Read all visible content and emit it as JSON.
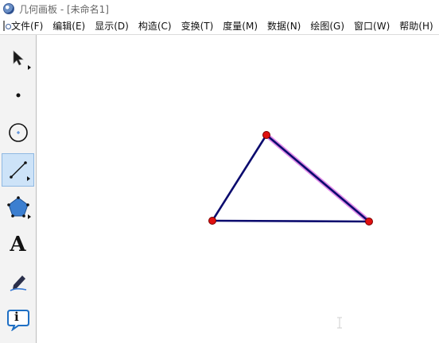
{
  "window": {
    "title": "几何画板 - [未命名1]"
  },
  "menubar": {
    "items": [
      "文件(F)",
      "编辑(E)",
      "显示(D)",
      "构造(C)",
      "变换(T)",
      "度量(M)",
      "数据(N)",
      "绘图(G)",
      "窗口(W)",
      "帮助(H)"
    ]
  },
  "toolbox": {
    "tools": [
      {
        "icon": "selection-arrow-icon",
        "active": false
      },
      {
        "icon": "point-tool-icon",
        "active": false
      },
      {
        "icon": "compass-tool-icon",
        "active": false
      },
      {
        "icon": "straightedge-tool-icon",
        "active": true
      },
      {
        "icon": "polygon-tool-icon",
        "active": false
      },
      {
        "icon": "text-tool-icon",
        "label": "A",
        "active": false
      },
      {
        "icon": "marker-tool-icon",
        "active": false
      },
      {
        "icon": "information-tool-icon",
        "label": "i",
        "active": false
      }
    ]
  },
  "canvas": {
    "colors": {
      "segment": "#0b0b6e",
      "point_fill": "#e01010",
      "point_stroke": "#7a0000",
      "selection_highlight": "#e08ae8"
    },
    "points": [
      {
        "id": "top"
      },
      {
        "id": "left"
      },
      {
        "id": "right"
      }
    ],
    "segments": [
      {
        "from": "top",
        "to": "left",
        "selected": false
      },
      {
        "from": "left",
        "to": "right",
        "selected": false
      },
      {
        "from": "top",
        "to": "right",
        "selected": true
      }
    ]
  }
}
